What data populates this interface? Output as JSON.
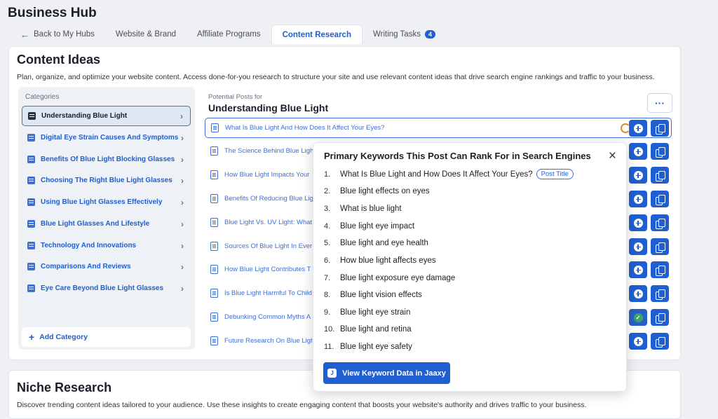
{
  "app": {
    "title": "Business Hub"
  },
  "tabs": [
    {
      "label": "Back to My Hubs"
    },
    {
      "label": "Website & Brand"
    },
    {
      "label": "Affiliate Programs"
    },
    {
      "label": "Content Research"
    },
    {
      "label": "Writing Tasks",
      "badge": "4"
    }
  ],
  "content_ideas": {
    "title": "Content Ideas",
    "description": "Plan, organize, and optimize your website content. Access done-for-you research to structure your site and use relevant content ideas that drive search engine rankings and traffic to your business.",
    "categories_label": "Categories",
    "categories": [
      "Understanding Blue Light",
      "Digital Eye Strain Causes And Symptoms",
      "Benefits Of Blue Light Blocking Glasses",
      "Choosing The Right Blue Light Glasses",
      "Using Blue Light Glasses Effectively",
      "Blue Light Glasses And Lifestyle",
      "Technology And Innovations",
      "Comparisons And Reviews",
      "Eye Care Beyond Blue Light Glasses"
    ],
    "add_category": "Add Category",
    "potential_label": "Potential Posts for",
    "selected_category": "Understanding Blue Light",
    "more": "···",
    "posts": [
      "What Is Blue Light And How Does It Affect Your Eyes?",
      "The Science Behind Blue Ligh",
      "How Blue Light Impacts Your",
      "Benefits Of Reducing Blue Lig",
      "Blue Light Vs. UV Light: What",
      "Sources Of Blue Light In Ever",
      "How Blue Light Contributes T",
      "Is Blue Light Harmful To Child",
      "Debunking Common Myths A",
      "Future Research On Blue Ligh"
    ]
  },
  "keywords_popup": {
    "title": "Primary Keywords This Post Can Rank For in Search Engines",
    "post_title_tag": "Post Title",
    "keywords": [
      {
        "num": "1.",
        "text": "What Is Blue Light and How Does It Affect Your Eyes?"
      },
      {
        "num": "2.",
        "text": "Blue light effects on eyes"
      },
      {
        "num": "3.",
        "text": "What is blue light"
      },
      {
        "num": "4.",
        "text": "Blue light eye impact"
      },
      {
        "num": "5.",
        "text": "Blue light and eye health"
      },
      {
        "num": "6.",
        "text": "How blue light affects eyes"
      },
      {
        "num": "7.",
        "text": "Blue light exposure eye damage"
      },
      {
        "num": "8.",
        "text": "Blue light vision effects"
      },
      {
        "num": "9.",
        "text": "Blue light eye strain"
      },
      {
        "num": "10.",
        "text": "Blue light and retina"
      },
      {
        "num": "11.",
        "text": "Blue light eye safety"
      }
    ],
    "button": "View Keyword Data in Jaaxy",
    "button_icon": "J"
  },
  "niche_research": {
    "title": "Niche Research",
    "description": "Discover trending content ideas tailored to your audience. Use these insights to create engaging content that boosts your website's authority and drives traffic to your business."
  }
}
